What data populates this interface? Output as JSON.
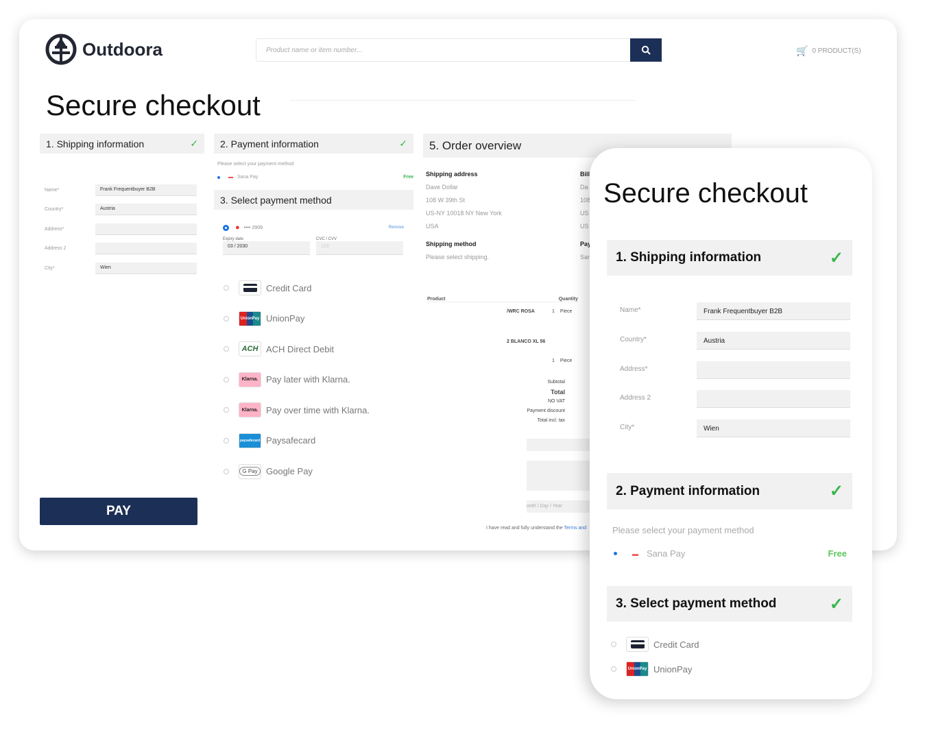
{
  "header": {
    "brand": "Outdoora",
    "search_placeholder": "Product name or item number...",
    "cart": "0 PRODUCT(S)"
  },
  "title": "Secure checkout",
  "shipping": {
    "heading": "1. Shipping information",
    "fields": [
      {
        "label": "Name*",
        "value": "Frank Frequentbuyer B2B"
      },
      {
        "label": "Country*",
        "value": "Austria"
      },
      {
        "label": "Address*",
        "value": ""
      },
      {
        "label": "Address 2",
        "value": ""
      },
      {
        "label": "City*",
        "value": "Wien"
      }
    ]
  },
  "payment_info": {
    "heading": "2. Payment information",
    "prompt": "Please select your payment method",
    "method": "Sana Pay",
    "price": "Free"
  },
  "select_payment": {
    "heading": "3. Select payment method",
    "card_number": "•••• 2909",
    "remove": "Remove",
    "expiry_label": "Expiry date",
    "expiry_value": "03 / 2030",
    "cvc_label": "CVC / CVV",
    "cvc_placeholder": "123",
    "methods": [
      {
        "label": "Credit Card",
        "icon": "credit-card-icon"
      },
      {
        "label": "UnionPay",
        "icon": "unionpay-icon"
      },
      {
        "label": "ACH Direct Debit",
        "icon": "ach-icon"
      },
      {
        "label": "Pay later with Klarna.",
        "icon": "klarna-icon"
      },
      {
        "label": "Pay over time with Klarna.",
        "icon": "klarna-icon"
      },
      {
        "label": "Paysafecard",
        "icon": "paysafecard-icon"
      },
      {
        "label": "Google Pay",
        "icon": "google-pay-icon"
      }
    ]
  },
  "pay_button": "PAY",
  "overview": {
    "heading": "5. Order overview",
    "shipping_address_label": "Shipping address",
    "address": [
      "Dave Dollar",
      "108 W 39th St",
      "US-NY 10018 NY New York",
      "USA"
    ],
    "billing_label": "Bill",
    "billing": [
      "Da",
      "108",
      "US",
      "US"
    ],
    "shipping_method_label": "Shipping method",
    "shipping_method": "Please select shipping.",
    "payment_label": "Pay",
    "payment_value": "Sar",
    "product_col": "Product",
    "quantity_col": "Quantity",
    "lines": [
      {
        "name": "/WRC ROSA",
        "qty": "1",
        "unit": "Piece"
      },
      {
        "name": "2 BLANCO XL 56",
        "qty": "",
        "unit": ""
      },
      {
        "name": "",
        "qty": "1",
        "unit": "Piece"
      }
    ],
    "totals": [
      "Subtotal",
      "Total",
      "NO VAT",
      "Payment discount",
      "Total incl. tax"
    ],
    "date_placeholder": "onth / Day / Year",
    "terms_text": "I have read and fully understand the ",
    "terms_link": "Terms and"
  },
  "colors": {
    "primary": "#1c2f57",
    "check": "#39b54a",
    "section_bg": "#f1f1f1"
  }
}
